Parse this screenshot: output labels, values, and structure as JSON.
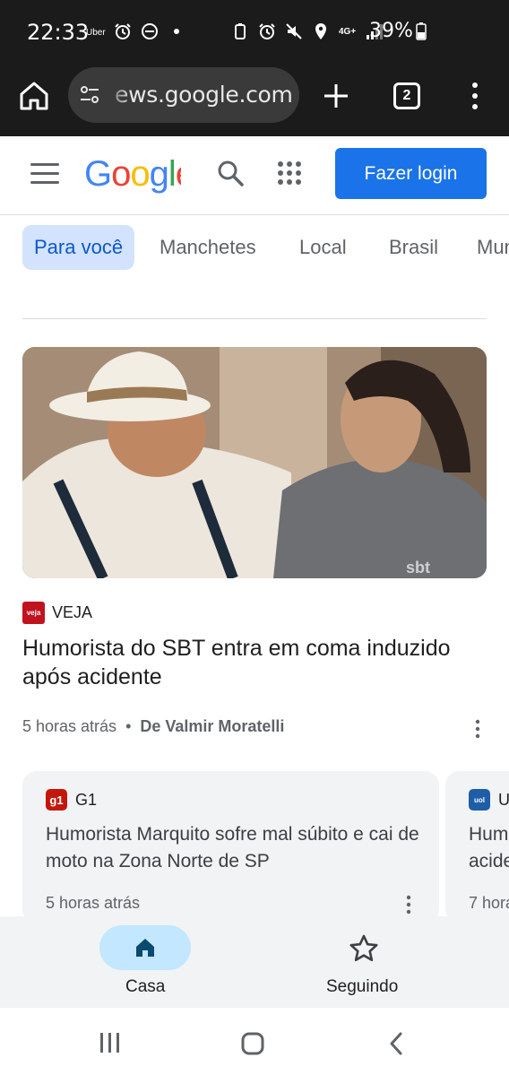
{
  "status_bar": {
    "time": "22:33",
    "uber_label": "Uber",
    "network": "4G+",
    "battery": "39%"
  },
  "browser": {
    "url": "ews.google.com",
    "tab_count": "2"
  },
  "header": {
    "logo_text": "Google",
    "login_label": "Fazer login"
  },
  "tabs": [
    {
      "label": "Para você",
      "active": true
    },
    {
      "label": "Manchetes",
      "active": false
    },
    {
      "label": "Local",
      "active": false
    },
    {
      "label": "Brasil",
      "active": false
    },
    {
      "label": "Mun",
      "active": false
    }
  ],
  "hero": {
    "publisher": "VEJA",
    "publisher_logo_text": "veja",
    "title": "Humorista do SBT entra em coma induzido após acidente",
    "time": "5 horas atrás",
    "separator": "•",
    "author": "De Valmir Moratelli",
    "image_watermark": "sbt"
  },
  "cards": [
    {
      "publisher": "G1",
      "logo_text": "g1",
      "title": "Humorista Marquito sofre mal súbito e cai de moto na Zona Norte de SP",
      "time": "5 horas atrás"
    },
    {
      "publisher": "U",
      "logo_text": "uol",
      "title": "Hum acide",
      "time": "7 hora"
    }
  ],
  "bottom_nav": {
    "home_label": "Casa",
    "following_label": "Seguindo"
  },
  "colors": {
    "accent": "#1a73e8",
    "active_tab_bg": "#d3e3fd",
    "active_nav_bg": "#c2e7ff"
  }
}
